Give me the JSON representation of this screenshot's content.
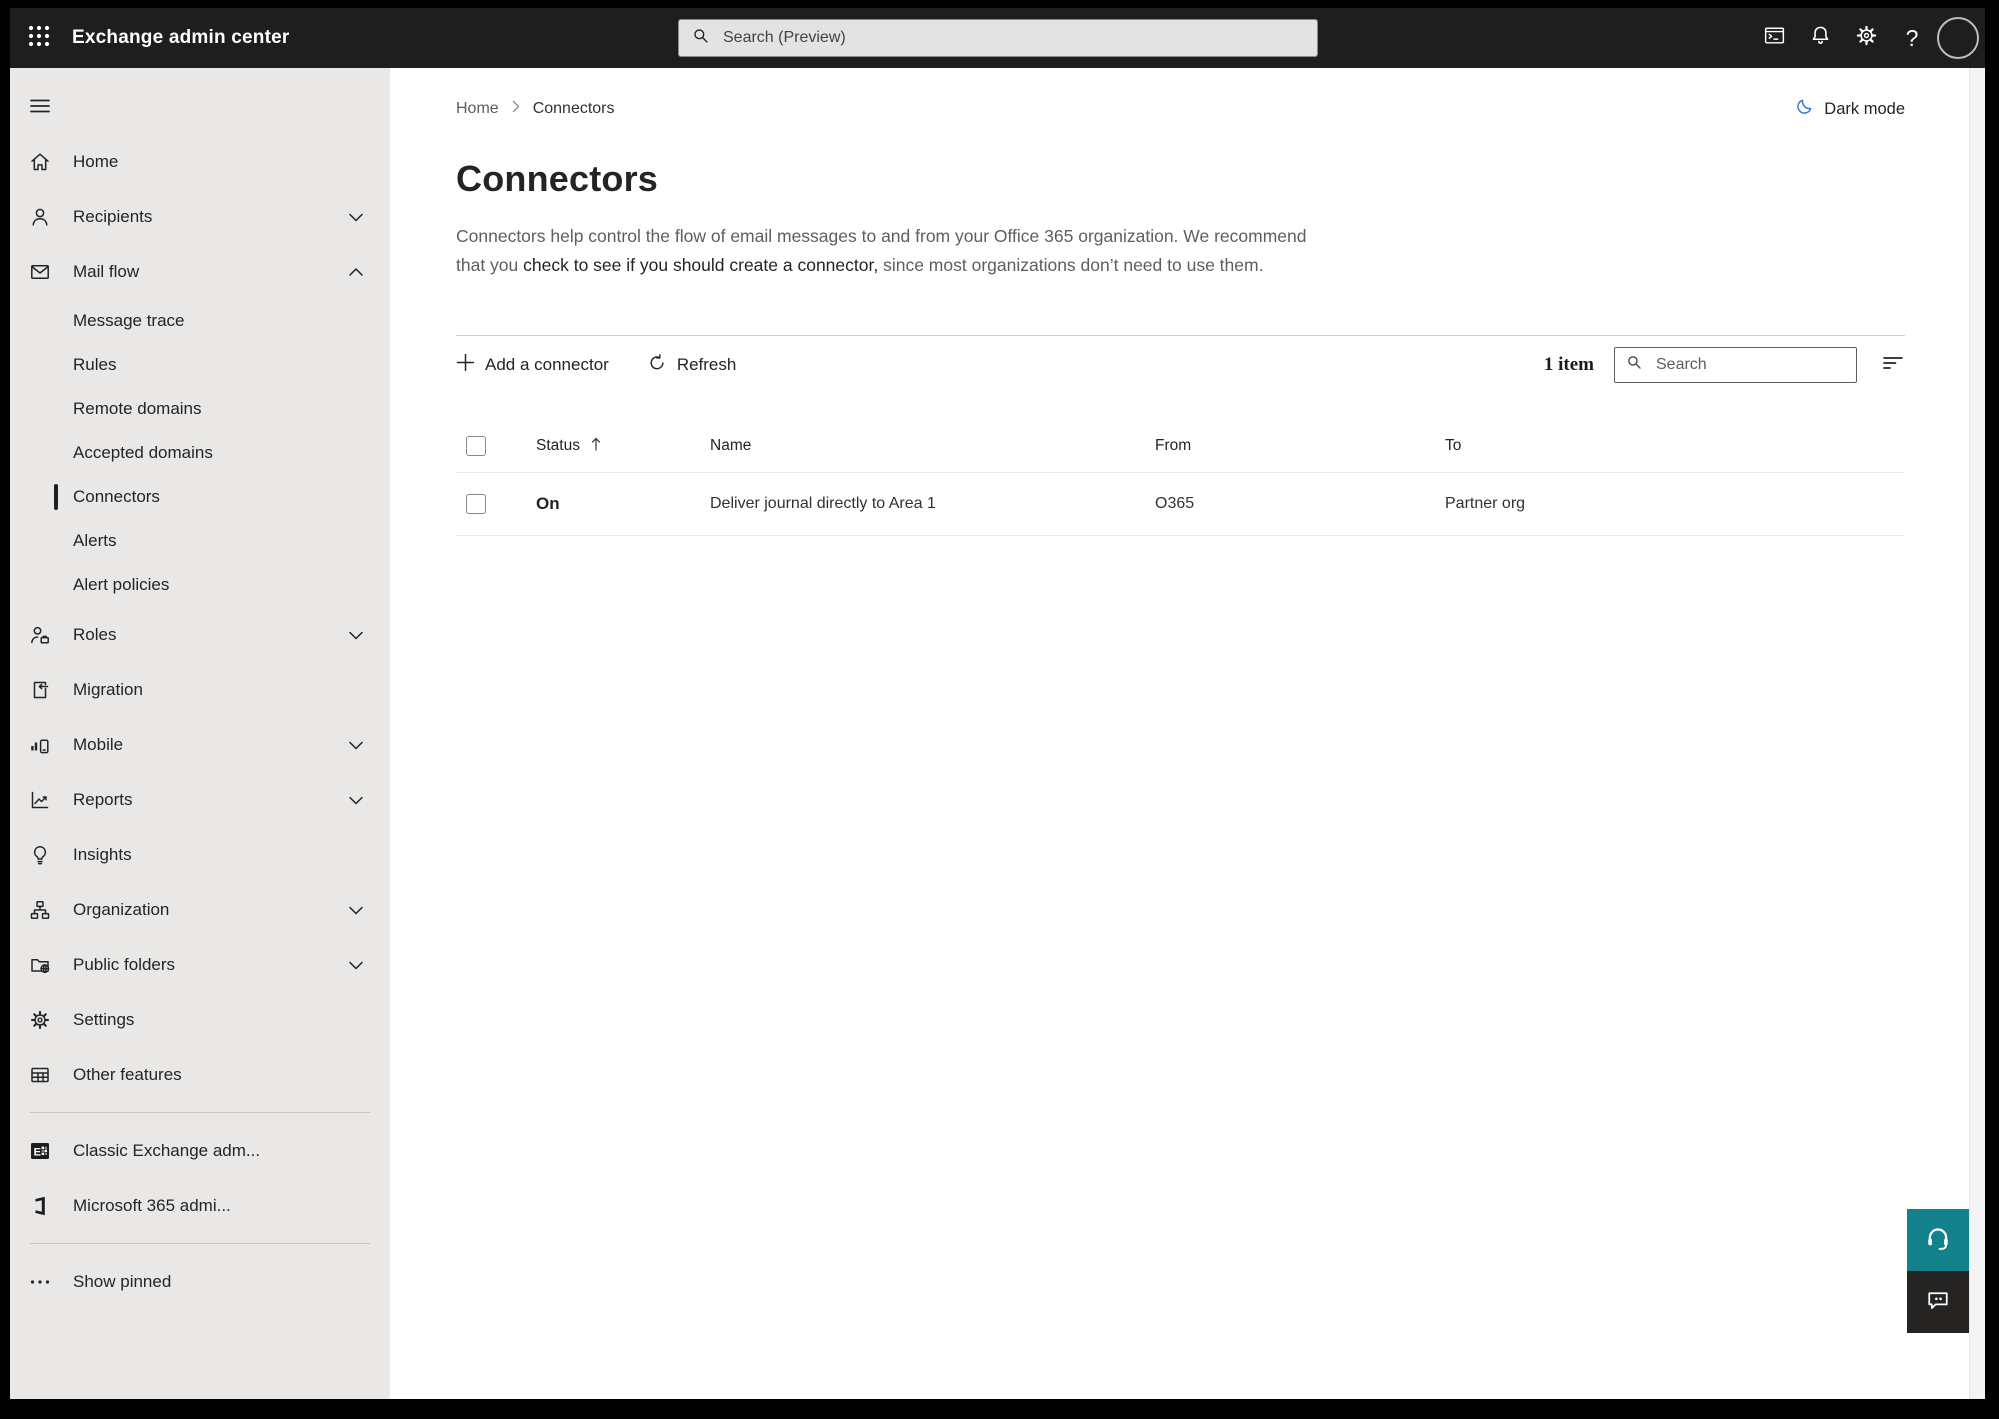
{
  "colors": {
    "topbar_bg": "#1e1e1e",
    "sidebar_bg": "#e9e8e7",
    "accent_teal": "#13818b",
    "moon_blue": "#3b76d6",
    "selected_indicator": "#1f1f1f",
    "text_dark": "#242424",
    "text_gray": "#605e5c"
  },
  "topbar": {
    "title": "Exchange admin center",
    "app_launcher_icon": "waffle-icon",
    "search": {
      "placeholder": "Search (Preview)",
      "icon": "search-icon"
    },
    "action_icons": [
      "powershell-terminal-icon",
      "notifications-bell-icon",
      "settings-gear-icon",
      "help-question-icon",
      "user-avatar"
    ]
  },
  "sidebar": {
    "menu_icon": "hamburger-icon",
    "items": [
      {
        "label": "Home",
        "icon": "home-icon"
      },
      {
        "label": "Recipients",
        "icon": "person-icon",
        "chevron": "down"
      },
      {
        "label": "Mail flow",
        "icon": "envelope-icon",
        "chevron": "up",
        "expanded": true
      },
      {
        "label": "Message trace",
        "sub": true
      },
      {
        "label": "Rules",
        "sub": true
      },
      {
        "label": "Remote domains",
        "sub": true
      },
      {
        "label": "Accepted domains",
        "sub": true
      },
      {
        "label": "Connectors",
        "sub": true,
        "selected": true
      },
      {
        "label": "Alerts",
        "sub": true
      },
      {
        "label": "Alert policies",
        "sub": true
      },
      {
        "label": "Roles",
        "icon": "roles-icon",
        "chevron": "down"
      },
      {
        "label": "Migration",
        "icon": "migration-icon"
      },
      {
        "label": "Mobile",
        "icon": "mobile-icon",
        "chevron": "down"
      },
      {
        "label": "Reports",
        "icon": "reports-icon",
        "chevron": "down"
      },
      {
        "label": "Insights",
        "icon": "lightbulb-icon"
      },
      {
        "label": "Organization",
        "icon": "org-chart-icon",
        "chevron": "down"
      },
      {
        "label": "Public folders",
        "icon": "public-folders-icon",
        "chevron": "down"
      },
      {
        "label": "Settings",
        "icon": "gear-icon"
      },
      {
        "label": "Other features",
        "icon": "table-icon"
      }
    ],
    "footer_items": [
      {
        "label": "Classic Exchange adm...",
        "icon": "exchange-logo-icon"
      },
      {
        "label": "Microsoft 365 admi...",
        "icon": "microsoft-365-logo-icon"
      }
    ],
    "show_pinned": {
      "label": "Show pinned",
      "icon": "ellipsis-icon"
    }
  },
  "breadcrumb": {
    "items": [
      "Home",
      "Connectors"
    ]
  },
  "dark_mode": {
    "label": "Dark mode",
    "icon": "moon-icon"
  },
  "page": {
    "title": "Connectors",
    "description": {
      "before": "Connectors help control the flow of email messages to and from your Office 365 organization. We recommend that you ",
      "emphasis": "check to see if you should create a connector,",
      "after": " since most organizations don’t need to use them."
    }
  },
  "toolbar": {
    "add_label": "Add a connector",
    "refresh_label": "Refresh",
    "item_count": "1 item",
    "search_placeholder": "Search",
    "filter_icon": "filter-icon"
  },
  "table": {
    "headers": [
      "Status",
      "Name",
      "From",
      "To"
    ],
    "sort": {
      "column": "Status",
      "direction": "ascending"
    },
    "rows": [
      {
        "status": "On",
        "name": "Deliver journal directly to Area 1",
        "from": "O365",
        "to": "Partner org"
      }
    ]
  },
  "help_widgets": [
    "headset-icon",
    "feedback-icon"
  ]
}
